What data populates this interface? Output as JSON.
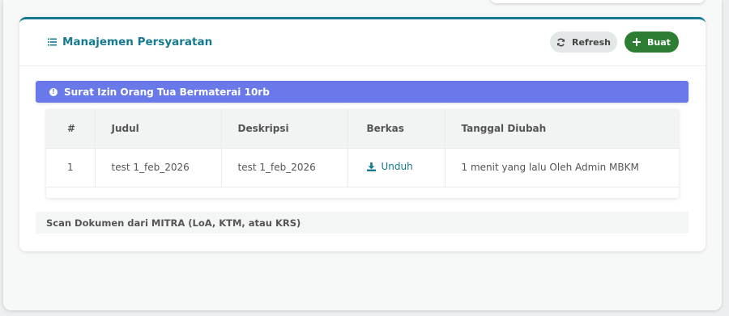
{
  "header": {
    "title": "Manajemen Persyaratan",
    "refresh_label": "Refresh",
    "create_label": "Buat"
  },
  "alert": {
    "text": "Surat Izin Orang Tua Bermaterai 10rb"
  },
  "table": {
    "headers": [
      "#",
      "Judul",
      "Deskripsi",
      "Berkas",
      "Tanggal Diubah"
    ],
    "rows": [
      {
        "num": "1",
        "judul": "test 1_feb_2026",
        "deskripsi": "test 1_feb_2026",
        "berkas": "Unduh",
        "tanggal": "1 menit yang lalu Oleh Admin MBKM"
      }
    ]
  },
  "footer": {
    "note": "Scan Dokumen dari MITRA (LoA, KTM, atau KRS)"
  },
  "icons": {
    "title": "list-icon",
    "refresh": "refresh-icon",
    "create": "plus-icon",
    "alert": "info-icon",
    "download": "download-icon"
  },
  "colors": {
    "accent": "#157a8f",
    "alert_bg": "#6a79ea",
    "create_bg": "#2d7d33",
    "refresh_bg": "#e3e7e8"
  }
}
